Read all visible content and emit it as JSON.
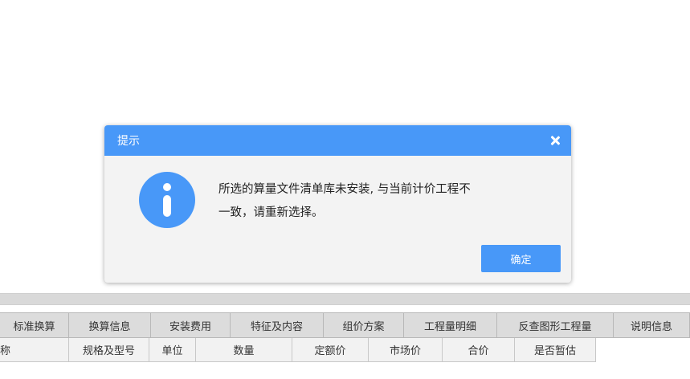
{
  "dialog": {
    "title": "提示",
    "message_line1": "所选的算量文件清单库未安装, 与当前计价工程不",
    "message_line2": "一致，请重新选择。",
    "ok_label": "确定"
  },
  "tabs": [
    "标准换算",
    "换算信息",
    "安装费用",
    "特征及内容",
    "组价方案",
    "工程量明细",
    "反查图形工程量",
    "说明信息"
  ],
  "table": {
    "headers": [
      "名称",
      "规格及型号",
      "单位",
      "数量",
      "定额价",
      "市场价",
      "合价",
      "是否暂估"
    ]
  },
  "colors": {
    "accent": "#4898f8"
  }
}
